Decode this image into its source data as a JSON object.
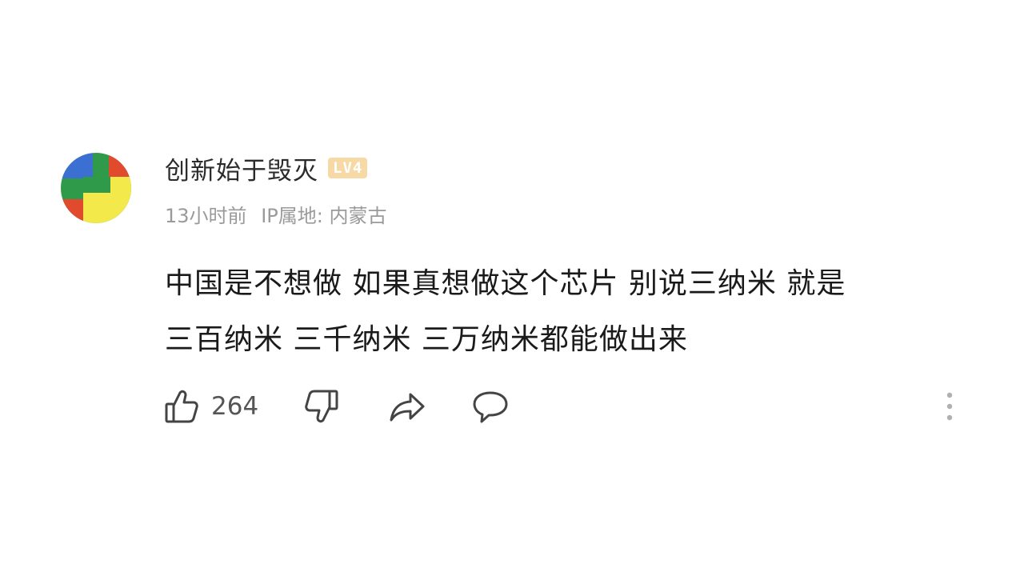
{
  "comment": {
    "avatar_icon": "avatar-icon",
    "username": "创新始于毁灭",
    "level_badge": "LV4",
    "time": "13小时前",
    "ip_location": "IP属地: 内蒙古",
    "content_lines": [
      "中国是不想做 如果真想做这个芯片 别说三纳米 就是",
      "三百纳米 三千纳米 三万纳米都能做出来"
    ],
    "like_count": "264",
    "icons": {
      "like": "thumbs-up-icon",
      "dislike": "thumbs-down-icon",
      "share": "share-icon",
      "reply": "reply-icon",
      "more": "more-vertical-icon"
    },
    "colors": {
      "text": "#1a1a1a",
      "meta": "#9a9a9a",
      "icon": "#444444",
      "badge": "#f7d9a6"
    }
  }
}
